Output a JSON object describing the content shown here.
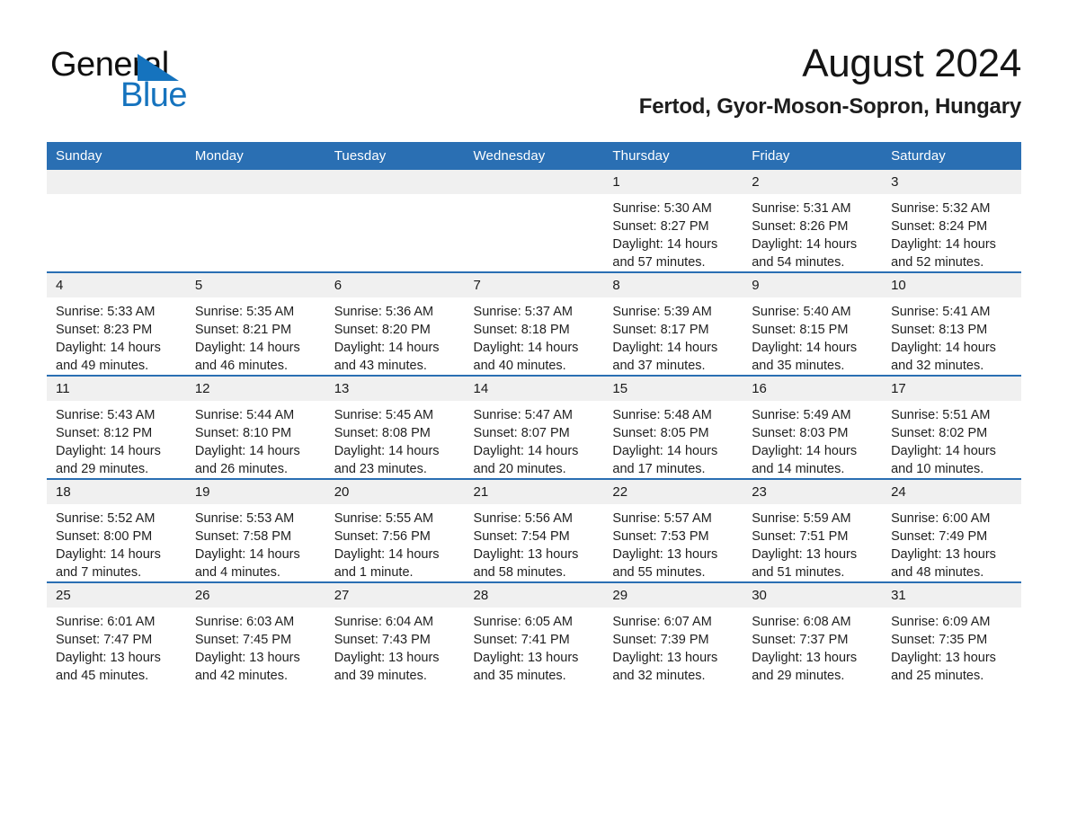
{
  "brand": {
    "name_part1": "General",
    "name_part2": "Blue",
    "triangle_color": "#1573be"
  },
  "header": {
    "month_title": "August 2024",
    "location": "Fertod, Gyor-Moson-Sopron, Hungary"
  },
  "colors": {
    "header_blue": "#2a6fb3",
    "daynum_band": "#f0f0f0",
    "text": "#1a1a1a",
    "brand_blue": "#1573be"
  },
  "calendar": {
    "weekday_headers": [
      "Sunday",
      "Monday",
      "Tuesday",
      "Wednesday",
      "Thursday",
      "Friday",
      "Saturday"
    ],
    "weeks": [
      [
        {
          "day": "",
          "sunrise": "",
          "sunset": "",
          "daylight": "",
          "empty": true
        },
        {
          "day": "",
          "sunrise": "",
          "sunset": "",
          "daylight": "",
          "empty": true
        },
        {
          "day": "",
          "sunrise": "",
          "sunset": "",
          "daylight": "",
          "empty": true
        },
        {
          "day": "",
          "sunrise": "",
          "sunset": "",
          "daylight": "",
          "empty": true
        },
        {
          "day": "1",
          "sunrise": "Sunrise: 5:30 AM",
          "sunset": "Sunset: 8:27 PM",
          "daylight": "Daylight: 14 hours and 57 minutes.",
          "empty": false
        },
        {
          "day": "2",
          "sunrise": "Sunrise: 5:31 AM",
          "sunset": "Sunset: 8:26 PM",
          "daylight": "Daylight: 14 hours and 54 minutes.",
          "empty": false
        },
        {
          "day": "3",
          "sunrise": "Sunrise: 5:32 AM",
          "sunset": "Sunset: 8:24 PM",
          "daylight": "Daylight: 14 hours and 52 minutes.",
          "empty": false
        }
      ],
      [
        {
          "day": "4",
          "sunrise": "Sunrise: 5:33 AM",
          "sunset": "Sunset: 8:23 PM",
          "daylight": "Daylight: 14 hours and 49 minutes.",
          "empty": false
        },
        {
          "day": "5",
          "sunrise": "Sunrise: 5:35 AM",
          "sunset": "Sunset: 8:21 PM",
          "daylight": "Daylight: 14 hours and 46 minutes.",
          "empty": false
        },
        {
          "day": "6",
          "sunrise": "Sunrise: 5:36 AM",
          "sunset": "Sunset: 8:20 PM",
          "daylight": "Daylight: 14 hours and 43 minutes.",
          "empty": false
        },
        {
          "day": "7",
          "sunrise": "Sunrise: 5:37 AM",
          "sunset": "Sunset: 8:18 PM",
          "daylight": "Daylight: 14 hours and 40 minutes.",
          "empty": false
        },
        {
          "day": "8",
          "sunrise": "Sunrise: 5:39 AM",
          "sunset": "Sunset: 8:17 PM",
          "daylight": "Daylight: 14 hours and 37 minutes.",
          "empty": false
        },
        {
          "day": "9",
          "sunrise": "Sunrise: 5:40 AM",
          "sunset": "Sunset: 8:15 PM",
          "daylight": "Daylight: 14 hours and 35 minutes.",
          "empty": false
        },
        {
          "day": "10",
          "sunrise": "Sunrise: 5:41 AM",
          "sunset": "Sunset: 8:13 PM",
          "daylight": "Daylight: 14 hours and 32 minutes.",
          "empty": false
        }
      ],
      [
        {
          "day": "11",
          "sunrise": "Sunrise: 5:43 AM",
          "sunset": "Sunset: 8:12 PM",
          "daylight": "Daylight: 14 hours and 29 minutes.",
          "empty": false
        },
        {
          "day": "12",
          "sunrise": "Sunrise: 5:44 AM",
          "sunset": "Sunset: 8:10 PM",
          "daylight": "Daylight: 14 hours and 26 minutes.",
          "empty": false
        },
        {
          "day": "13",
          "sunrise": "Sunrise: 5:45 AM",
          "sunset": "Sunset: 8:08 PM",
          "daylight": "Daylight: 14 hours and 23 minutes.",
          "empty": false
        },
        {
          "day": "14",
          "sunrise": "Sunrise: 5:47 AM",
          "sunset": "Sunset: 8:07 PM",
          "daylight": "Daylight: 14 hours and 20 minutes.",
          "empty": false
        },
        {
          "day": "15",
          "sunrise": "Sunrise: 5:48 AM",
          "sunset": "Sunset: 8:05 PM",
          "daylight": "Daylight: 14 hours and 17 minutes.",
          "empty": false
        },
        {
          "day": "16",
          "sunrise": "Sunrise: 5:49 AM",
          "sunset": "Sunset: 8:03 PM",
          "daylight": "Daylight: 14 hours and 14 minutes.",
          "empty": false
        },
        {
          "day": "17",
          "sunrise": "Sunrise: 5:51 AM",
          "sunset": "Sunset: 8:02 PM",
          "daylight": "Daylight: 14 hours and 10 minutes.",
          "empty": false
        }
      ],
      [
        {
          "day": "18",
          "sunrise": "Sunrise: 5:52 AM",
          "sunset": "Sunset: 8:00 PM",
          "daylight": "Daylight: 14 hours and 7 minutes.",
          "empty": false
        },
        {
          "day": "19",
          "sunrise": "Sunrise: 5:53 AM",
          "sunset": "Sunset: 7:58 PM",
          "daylight": "Daylight: 14 hours and 4 minutes.",
          "empty": false
        },
        {
          "day": "20",
          "sunrise": "Sunrise: 5:55 AM",
          "sunset": "Sunset: 7:56 PM",
          "daylight": "Daylight: 14 hours and 1 minute.",
          "empty": false
        },
        {
          "day": "21",
          "sunrise": "Sunrise: 5:56 AM",
          "sunset": "Sunset: 7:54 PM",
          "daylight": "Daylight: 13 hours and 58 minutes.",
          "empty": false
        },
        {
          "day": "22",
          "sunrise": "Sunrise: 5:57 AM",
          "sunset": "Sunset: 7:53 PM",
          "daylight": "Daylight: 13 hours and 55 minutes.",
          "empty": false
        },
        {
          "day": "23",
          "sunrise": "Sunrise: 5:59 AM",
          "sunset": "Sunset: 7:51 PM",
          "daylight": "Daylight: 13 hours and 51 minutes.",
          "empty": false
        },
        {
          "day": "24",
          "sunrise": "Sunrise: 6:00 AM",
          "sunset": "Sunset: 7:49 PM",
          "daylight": "Daylight: 13 hours and 48 minutes.",
          "empty": false
        }
      ],
      [
        {
          "day": "25",
          "sunrise": "Sunrise: 6:01 AM",
          "sunset": "Sunset: 7:47 PM",
          "daylight": "Daylight: 13 hours and 45 minutes.",
          "empty": false
        },
        {
          "day": "26",
          "sunrise": "Sunrise: 6:03 AM",
          "sunset": "Sunset: 7:45 PM",
          "daylight": "Daylight: 13 hours and 42 minutes.",
          "empty": false
        },
        {
          "day": "27",
          "sunrise": "Sunrise: 6:04 AM",
          "sunset": "Sunset: 7:43 PM",
          "daylight": "Daylight: 13 hours and 39 minutes.",
          "empty": false
        },
        {
          "day": "28",
          "sunrise": "Sunrise: 6:05 AM",
          "sunset": "Sunset: 7:41 PM",
          "daylight": "Daylight: 13 hours and 35 minutes.",
          "empty": false
        },
        {
          "day": "29",
          "sunrise": "Sunrise: 6:07 AM",
          "sunset": "Sunset: 7:39 PM",
          "daylight": "Daylight: 13 hours and 32 minutes.",
          "empty": false
        },
        {
          "day": "30",
          "sunrise": "Sunrise: 6:08 AM",
          "sunset": "Sunset: 7:37 PM",
          "daylight": "Daylight: 13 hours and 29 minutes.",
          "empty": false
        },
        {
          "day": "31",
          "sunrise": "Sunrise: 6:09 AM",
          "sunset": "Sunset: 7:35 PM",
          "daylight": "Daylight: 13 hours and 25 minutes.",
          "empty": false
        }
      ]
    ]
  }
}
